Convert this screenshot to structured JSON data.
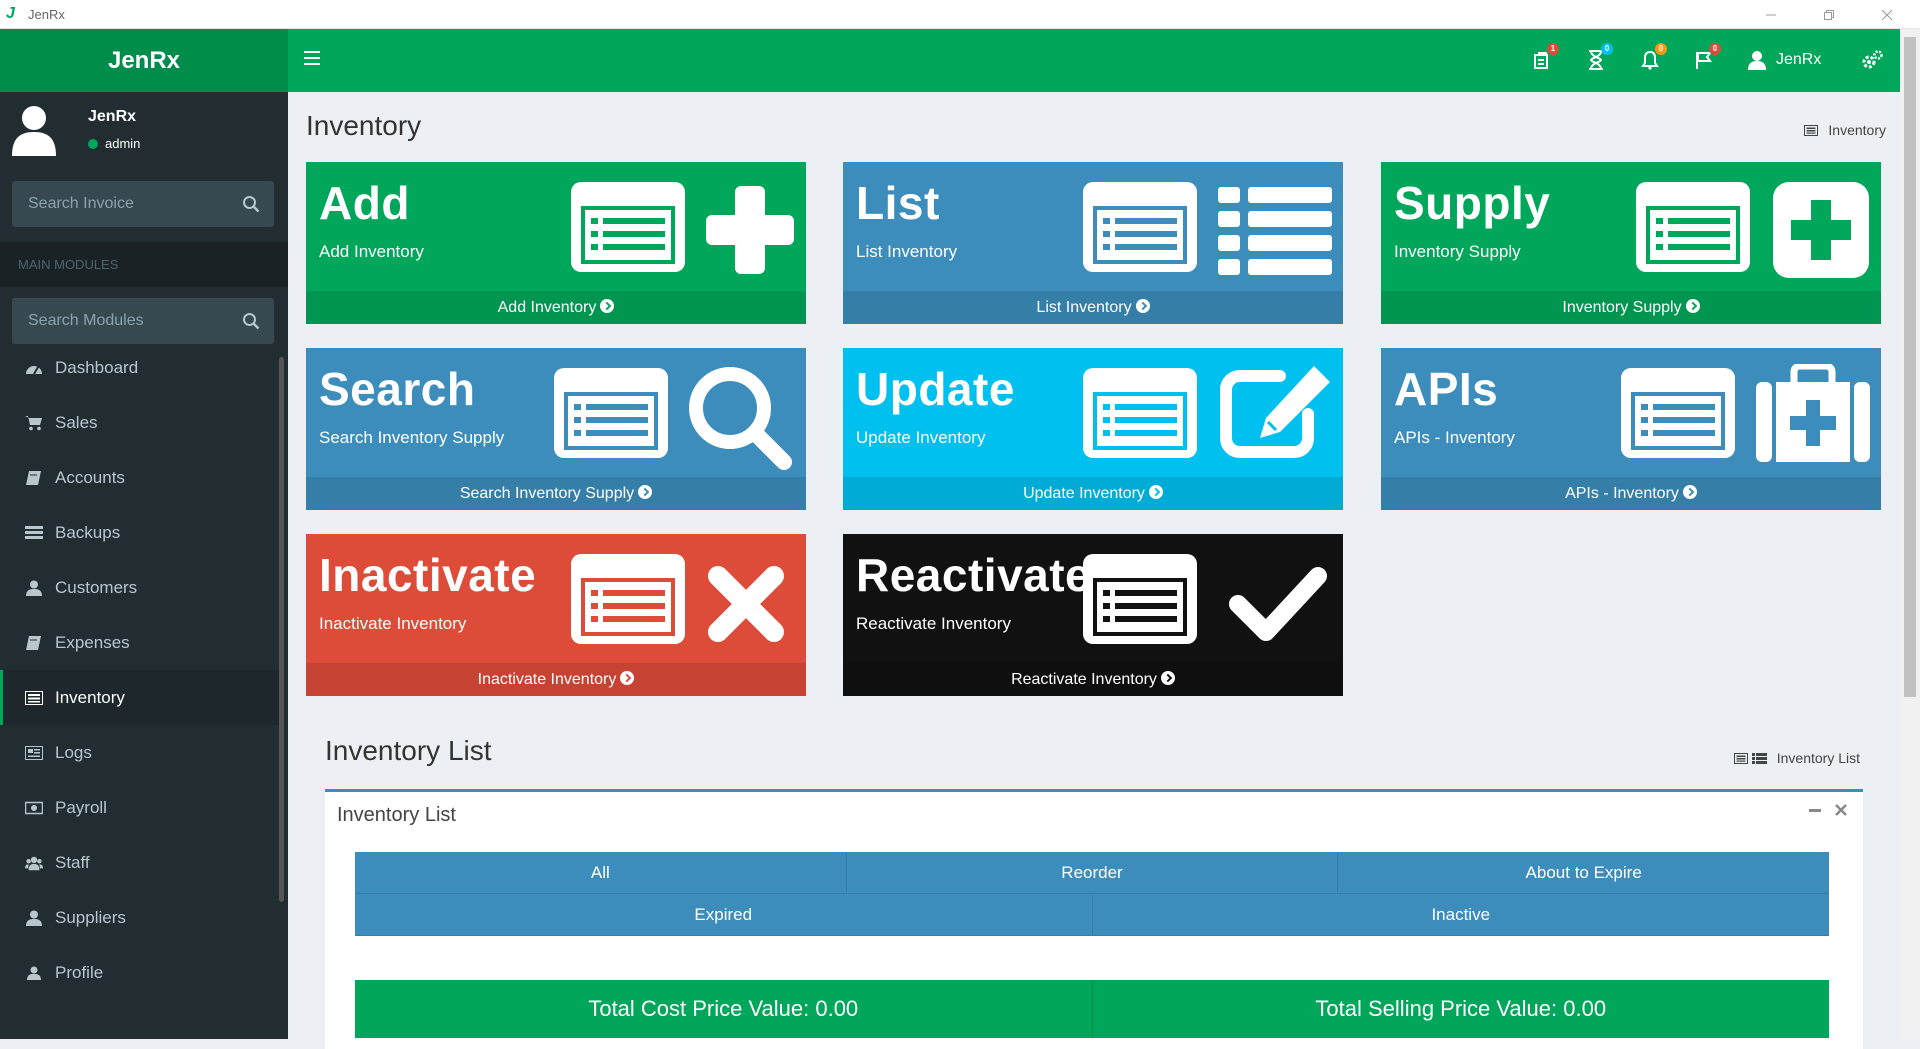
{
  "window": {
    "title": "JenRx"
  },
  "header": {
    "logo": "JenRx",
    "badges": {
      "orders": "1",
      "hourglass": "0",
      "bell": "0",
      "flag": "0"
    },
    "user": "JenRx"
  },
  "sidebar": {
    "user": {
      "name": "JenRx",
      "role": "admin"
    },
    "search_invoice_placeholder": "Search Invoice",
    "section_label": "MAIN MODULES",
    "search_modules_placeholder": "Search Modules",
    "items": [
      {
        "label": "Dashboard",
        "icon": "dashboard-icon"
      },
      {
        "label": "Sales",
        "icon": "cart-icon"
      },
      {
        "label": "Accounts",
        "icon": "book-icon"
      },
      {
        "label": "Backups",
        "icon": "list-icon"
      },
      {
        "label": "Customers",
        "icon": "user-icon"
      },
      {
        "label": "Expenses",
        "icon": "book-icon"
      },
      {
        "label": "Inventory",
        "icon": "list-alt-icon",
        "active": true
      },
      {
        "label": "Logs",
        "icon": "newspaper-icon"
      },
      {
        "label": "Payroll",
        "icon": "money-icon"
      },
      {
        "label": "Staff",
        "icon": "users-icon"
      },
      {
        "label": "Suppliers",
        "icon": "user-icon"
      },
      {
        "label": "Profile",
        "icon": "user-icon"
      }
    ]
  },
  "main": {
    "title": "Inventory",
    "breadcrumb": "Inventory",
    "tiles": [
      {
        "heading": "Add",
        "sub": "Add Inventory",
        "link": "Add Inventory"
      },
      {
        "heading": "List",
        "sub": "List Inventory",
        "link": "List Inventory"
      },
      {
        "heading": "Supply",
        "sub": "Inventory Supply",
        "link": "Inventory Supply"
      },
      {
        "heading": "Search",
        "sub": "Search Inventory Supply",
        "link": "Search Inventory Supply"
      },
      {
        "heading": "Update",
        "sub": "Update Inventory",
        "link": "Update Inventory"
      },
      {
        "heading": "APIs",
        "sub": "APIs - Inventory",
        "link": "APIs - Inventory"
      },
      {
        "heading": "Inactivate",
        "sub": "Inactivate Inventory",
        "link": "Inactivate Inventory"
      },
      {
        "heading": "Reactivate",
        "sub": "Reactivate Inventory",
        "link": "Reactivate Inventory"
      }
    ],
    "list_section": {
      "title": "Inventory List",
      "breadcrumb": "Inventory List",
      "box_title": "Inventory List",
      "tabs_row1": [
        "All",
        "Reorder",
        "About to Expire"
      ],
      "tabs_row2": [
        "Expired",
        "Inactive"
      ],
      "total_cost": "Total Cost Price Value: 0.00",
      "total_selling": "Total Selling Price Value: 0.00"
    }
  },
  "colors": {
    "green": "#00a65a",
    "blue": "#3c8dbc",
    "aqua": "#00c0ef",
    "red": "#dd4b39",
    "dark": "#222d32"
  }
}
